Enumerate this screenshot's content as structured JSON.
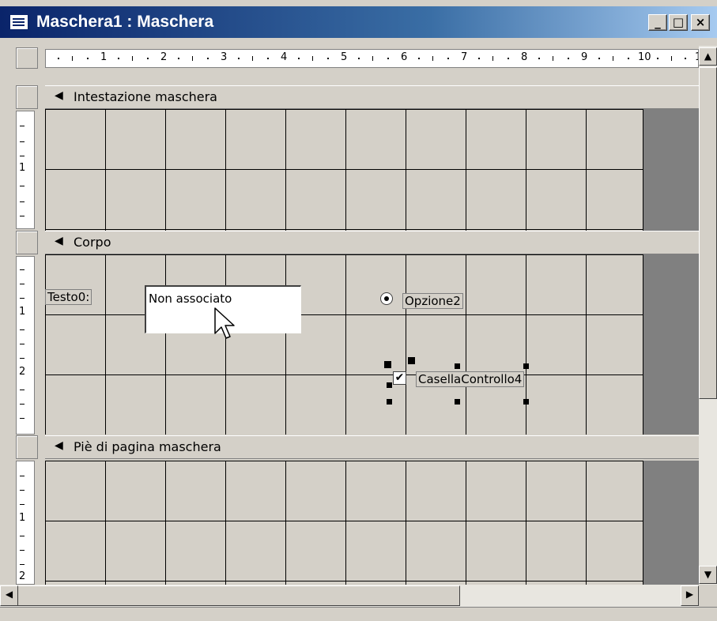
{
  "window": {
    "title": "Maschera1 : Maschera",
    "minimize_glyph": "_",
    "maximize_glyph": "□",
    "close_glyph": "×"
  },
  "ruler": {
    "numbers": [
      "1",
      "2",
      "3",
      "4",
      "5",
      "6",
      "7",
      "8",
      "9",
      "10",
      "1"
    ]
  },
  "sections": [
    {
      "arrow": "◀",
      "label": "Intestazione maschera"
    },
    {
      "arrow": "◀",
      "label": "Corpo"
    },
    {
      "arrow": "◀",
      "label": "Piè di pagina maschera"
    }
  ],
  "vruler_numbers": {
    "header": [
      "1"
    ],
    "body": [
      "1",
      "2"
    ],
    "footer": [
      "1",
      "2"
    ]
  },
  "controls": {
    "label_text": "Testo0:",
    "textbox_value": "Non associato",
    "option_label": "Opzione2",
    "checkbox_label": "CasellaControllo4",
    "checkbox_mark": "✔"
  },
  "scroll": {
    "up": "▲",
    "down": "▼",
    "left": "◀",
    "right": "▶"
  },
  "colors": {
    "titlebar_start": "#0a246a",
    "titlebar_end": "#a6caf0",
    "face": "#d4d0c8",
    "dark_area": "#808080"
  }
}
